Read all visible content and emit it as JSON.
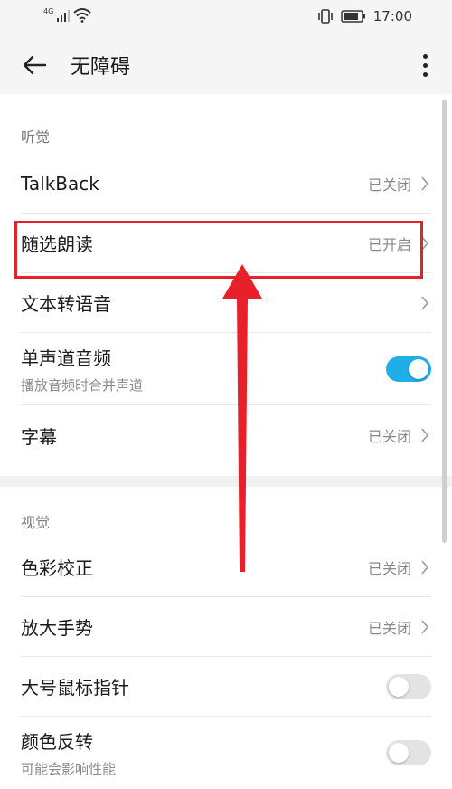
{
  "status_bar": {
    "network": "4G",
    "time": "17:00"
  },
  "header": {
    "title": "无障碍"
  },
  "sections": [
    {
      "header": "听觉",
      "items": [
        {
          "label": "TalkBack",
          "status": "已关闭"
        },
        {
          "label": "随选朗读",
          "status": "已开启"
        },
        {
          "label": "文本转语音",
          "status": ""
        },
        {
          "label": "单声道音频",
          "subtitle": "播放音频时合并声道",
          "toggle": "on"
        },
        {
          "label": "字幕",
          "status": "已关闭"
        }
      ]
    },
    {
      "header": "视觉",
      "items": [
        {
          "label": "色彩校正",
          "status": "已关闭"
        },
        {
          "label": "放大手势",
          "status": "已关闭"
        },
        {
          "label": "大号鼠标指针",
          "toggle": "off"
        },
        {
          "label": "颜色反转",
          "subtitle": "可能会影响性能",
          "toggle": "off"
        }
      ]
    }
  ],
  "colors": {
    "accent": "#1faee8",
    "highlight": "#e8202a"
  }
}
